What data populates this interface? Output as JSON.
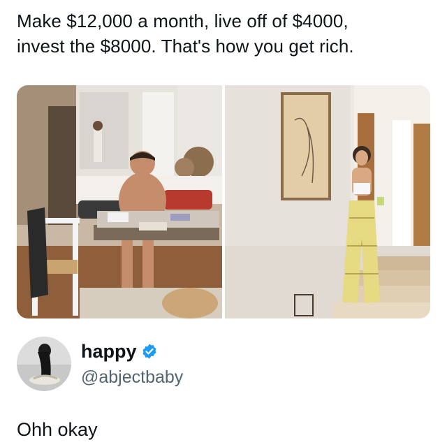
{
  "quoted_post": {
    "text": "Make $12,000 a month, live off of $4000,\ninvest the $8000. That's how you get rich."
  },
  "media": [
    {
      "icon": "photo-man-at-table-kitchen"
    },
    {
      "icon": "photo-woman-in-hallway-stairs"
    }
  ],
  "author": {
    "display_name": "happy",
    "handle": "@abjectbaby",
    "verified": true,
    "verified_color": "#1d9bf0",
    "avatar_icon": "avatar-photo"
  },
  "reply": {
    "text": "Ohh okay"
  },
  "colors": {
    "text_primary": "#0f1419",
    "text_secondary": "#536471",
    "background": "#ffffff"
  }
}
